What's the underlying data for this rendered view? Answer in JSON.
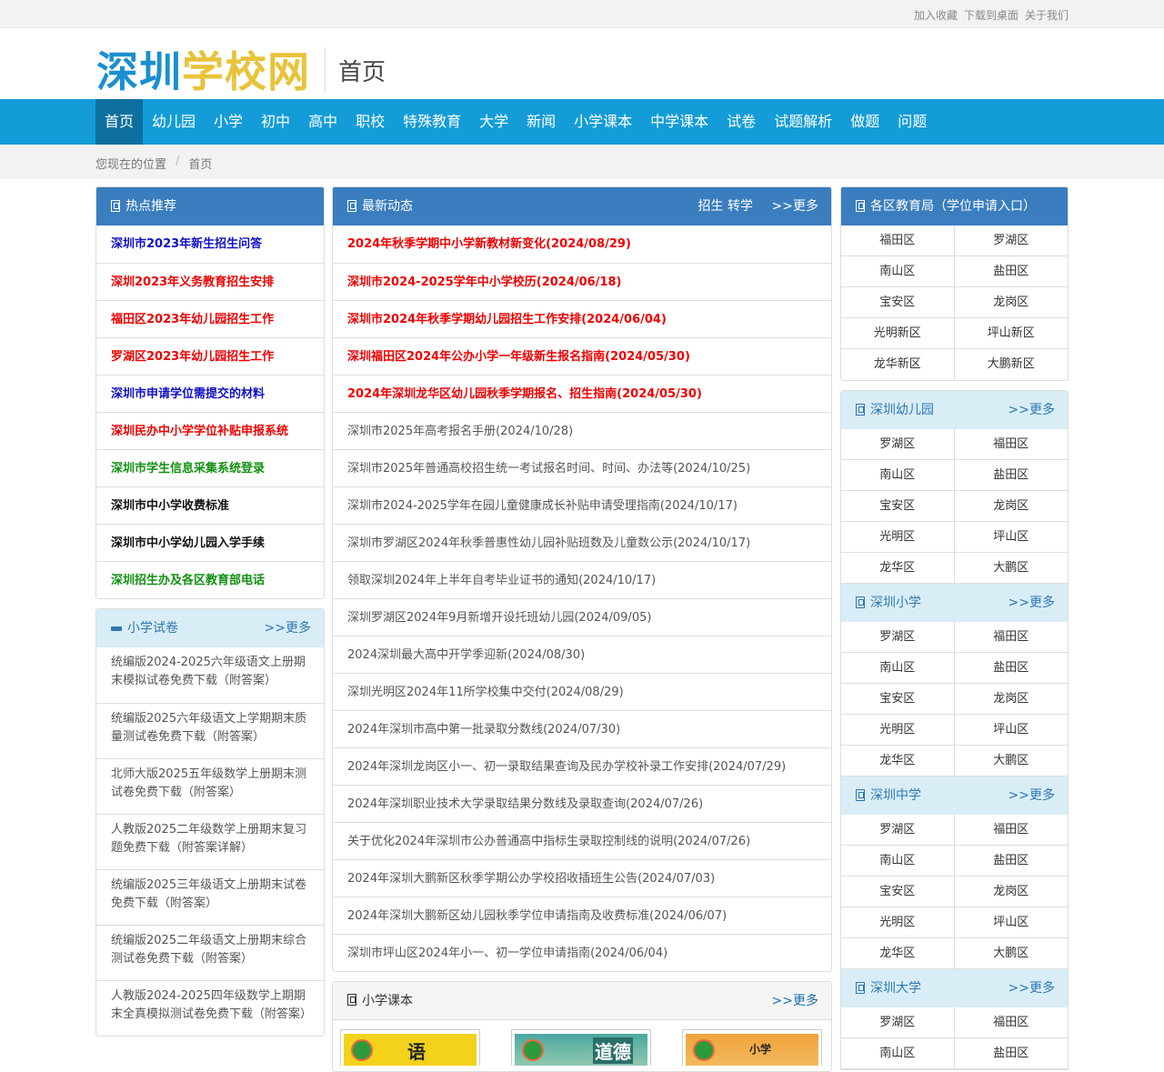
{
  "topbar": {
    "links": [
      "加入收藏",
      "下载到桌面",
      "关于我们"
    ]
  },
  "header": {
    "logo_part1": "深圳",
    "logo_part2": "学校网",
    "page_title": "首页"
  },
  "nav": {
    "items": [
      "首页",
      "幼儿园",
      "小学",
      "初中",
      "高中",
      "职校",
      "特殊教育",
      "大学",
      "新闻",
      "小学课本",
      "中学课本",
      "试卷",
      "试题解析",
      "做题",
      "问题"
    ]
  },
  "breadcrumb": {
    "label": "您现在的位置",
    "sep": "/",
    "current": "首页"
  },
  "hot": {
    "title": "热点推荐",
    "items": [
      {
        "text": "深圳市2023年新生招生问答",
        "color": "blue"
      },
      {
        "text": "深圳2023年义务教育招生安排",
        "color": "red"
      },
      {
        "text": "福田区2023年幼儿园招生工作",
        "color": "red"
      },
      {
        "text": "罗湖区2023年幼儿园招生工作",
        "color": "red"
      },
      {
        "text": "深圳市申请学位需提交的材料",
        "color": "blue"
      },
      {
        "text": "深圳民办中小学学位补贴申报系统",
        "color": "red"
      },
      {
        "text": "深圳市学生信息采集系统登录",
        "color": "green"
      },
      {
        "text": "深圳市中小学收费标准",
        "color": "black"
      },
      {
        "text": "深圳市中小学幼儿园入学手续",
        "color": "black"
      },
      {
        "text": "深圳招生办及各区教育部电话",
        "color": "green"
      }
    ]
  },
  "papers": {
    "title": "小学试卷",
    "more": ">>更多",
    "items": [
      "统编版2024-2025六年级语文上册期末模拟试卷免费下载（附答案）",
      "统编版2025六年级语文上学期期末质量测试卷免费下载（附答案）",
      "北师大版2025五年级数学上册期末测试卷免费下载（附答案）",
      "人教版2025二年级数学上册期末复习题免费下载（附答案详解）",
      "统编版2025三年级语文上册期末试卷免费下载（附答案）",
      "统编版2025二年级语文上册期末综合测试卷免费下载（附答案）",
      "人教版2024-2025四年级数学上期期末全真模拟测试卷免费下载（附答案）"
    ]
  },
  "news": {
    "title": "最新动态",
    "extra": "招生 转学",
    "more": ">>更多",
    "items": [
      {
        "text": "2024年秋季学期中小学新教材新变化(2024/08/29)",
        "hot": true
      },
      {
        "text": "深圳市2024-2025学年中小学校历(2024/06/18)",
        "hot": true
      },
      {
        "text": "深圳市2024年秋季学期幼儿园招生工作安排(2024/06/04)",
        "hot": true
      },
      {
        "text": "深圳福田区2024年公办小学一年级新生报名指南(2024/05/30)",
        "hot": true
      },
      {
        "text": "2024年深圳龙华区幼儿园秋季学期报名、招生指南(2024/05/30)",
        "hot": true
      },
      {
        "text": "深圳市2025年高考报名手册(2024/10/28)",
        "hot": false
      },
      {
        "text": "深圳市2025年普通高校招生统一考试报名时间、时间、办法等(2024/10/25)",
        "hot": false
      },
      {
        "text": "深圳市2024-2025学年在园儿童健康成长补贴申请受理指南(2024/10/17)",
        "hot": false
      },
      {
        "text": "深圳市罗湖区2024年秋季普惠性幼儿园补贴班数及儿童数公示(2024/10/17)",
        "hot": false
      },
      {
        "text": "领取深圳2024年上半年自考毕业证书的通知(2024/10/17)",
        "hot": false
      },
      {
        "text": "深圳罗湖区2024年9月新增开设托班幼儿园(2024/09/05)",
        "hot": false
      },
      {
        "text": "2024深圳最大高中开学季迎新(2024/08/30)",
        "hot": false
      },
      {
        "text": "深圳光明区2024年11所学校集中交付(2024/08/29)",
        "hot": false
      },
      {
        "text": "2024年深圳市高中第一批录取分数线(2024/07/30)",
        "hot": false
      },
      {
        "text": "2024年深圳龙岗区小一、初一录取结果查询及民办学校补录工作安排(2024/07/29)",
        "hot": false
      },
      {
        "text": "2024年深圳职业技术大学录取结果分数线及录取查询(2024/07/26)",
        "hot": false
      },
      {
        "text": "关于优化2024年深圳市公办普通高中指标生录取控制线的说明(2024/07/26)",
        "hot": false
      },
      {
        "text": "2024年深圳大鹏新区秋季学期公办学校招收插班生公告(2024/07/03)",
        "hot": false
      },
      {
        "text": "2024年深圳大鹏新区幼儿园秋季学位申请指南及收费标准(2024/06/07)",
        "hot": false
      },
      {
        "text": "深圳市坪山区2024年小一、初一学位申请指南(2024/06/04)",
        "hot": false
      }
    ]
  },
  "textbooks": {
    "title": "小学课本",
    "more": ">>更多",
    "covers": [
      "语",
      "道德",
      "小学"
    ]
  },
  "bureau": {
    "title": "各区教育局（学位申请入口）",
    "districts": [
      "福田区",
      "罗湖区",
      "南山区",
      "盐田区",
      "宝安区",
      "龙岗区",
      "光明新区",
      "坪山新区",
      "龙华新区",
      "大鹏新区"
    ]
  },
  "kinder": {
    "title": "深圳幼儿园",
    "more": ">>更多",
    "districts": [
      "罗湖区",
      "福田区",
      "南山区",
      "盐田区",
      "宝安区",
      "龙岗区",
      "光明区",
      "坪山区",
      "龙华区",
      "大鹏区"
    ]
  },
  "primary": {
    "title": "深圳小学",
    "more": ">>更多",
    "districts": [
      "罗湖区",
      "福田区",
      "南山区",
      "盐田区",
      "宝安区",
      "龙岗区",
      "光明区",
      "坪山区",
      "龙华区",
      "大鹏区"
    ]
  },
  "middle": {
    "title": "深圳中学",
    "more": ">>更多",
    "districts": [
      "罗湖区",
      "福田区",
      "南山区",
      "盐田区",
      "宝安区",
      "龙岗区",
      "光明区",
      "坪山区",
      "龙华区",
      "大鹏区"
    ]
  },
  "univ": {
    "title": "深圳大学",
    "more": ">>更多",
    "districts": [
      "罗湖区",
      "福田区",
      "南山区",
      "盐田区"
    ]
  },
  "colors": {
    "nav": "#139cd8",
    "nav_active": "#0d6f9e",
    "panel_header": "#3a7ebf",
    "sub_header": "#d9edf7",
    "hot_red": "#ee0000"
  }
}
